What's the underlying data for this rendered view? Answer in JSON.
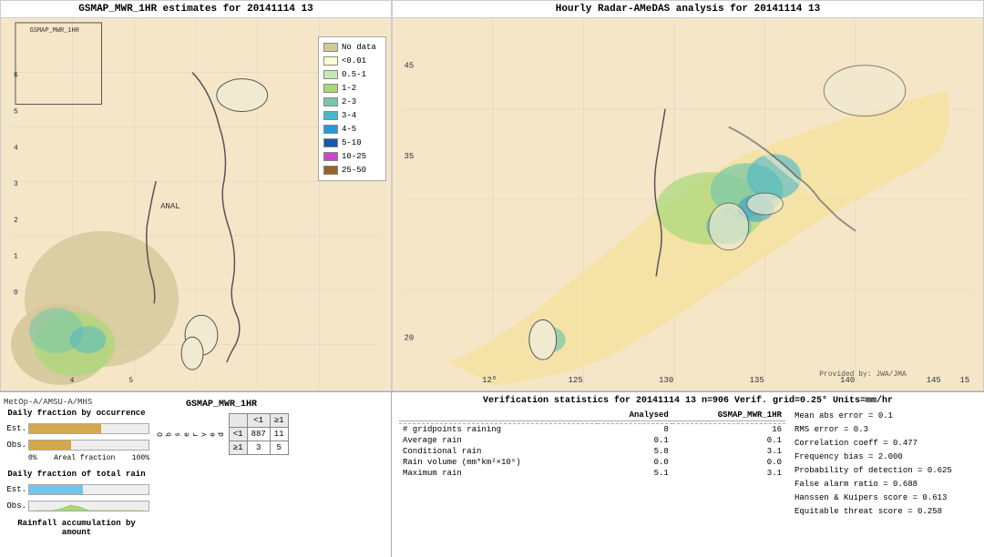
{
  "left_map": {
    "title": "GSMAP_MWR_1HR estimates for 20141114 13",
    "subtitle": "GSMAP_MWR_1HR",
    "anal_label": "ANAL",
    "satellite": "MetOp-A/AMSU-A/MHS"
  },
  "right_map": {
    "title": "Hourly Radar-AMeDAS analysis for 20141114 13",
    "provided_by": "Provided by: JWA/JMA"
  },
  "legend": {
    "title": "",
    "items": [
      {
        "label": "No data",
        "color": "#d4c89a"
      },
      {
        "label": "<0.01",
        "color": "#ffffd4"
      },
      {
        "label": "0.5-1",
        "color": "#c8e8b4"
      },
      {
        "label": "1-2",
        "color": "#a8d878"
      },
      {
        "label": "2-3",
        "color": "#78c8a8"
      },
      {
        "label": "3-4",
        "color": "#48b8c8"
      },
      {
        "label": "4-5",
        "color": "#2898d8"
      },
      {
        "label": "5-10",
        "color": "#1858a8"
      },
      {
        "label": "10-25",
        "color": "#c848c8"
      },
      {
        "label": "25-50",
        "color": "#986428"
      }
    ]
  },
  "charts": {
    "occurrence_title": "Daily fraction by occurrence",
    "total_rain_title": "Daily fraction of total rain",
    "accumulation_title": "Rainfall accumulation by amount",
    "est_label": "Est.",
    "obs_label": "Obs.",
    "axis_left": "0%",
    "axis_right": "100%",
    "axis_mid": "Areal fraction"
  },
  "confusion_matrix": {
    "title": "GSMAP_MWR_1HR",
    "col_lt1": "<1",
    "col_ge1": "≥1",
    "row_lt1": "<1",
    "row_ge1": "≥1",
    "observed_label": "O\nb\ns\ne\nr\nv\ne\nd",
    "val_tt": "887",
    "val_tf": "11",
    "val_ft": "3",
    "val_ff": "5"
  },
  "verification": {
    "title": "Verification statistics for 20141114 13  n=906  Verif. grid=0.25°  Units=mm/hr",
    "headers": [
      "",
      "Analysed",
      "GSMAP_MWR_1HR"
    ],
    "rows": [
      {
        "label": "# gridpoints raining",
        "analysed": "8",
        "gsmap": "16"
      },
      {
        "label": "Average rain",
        "analysed": "0.1",
        "gsmap": "0.1"
      },
      {
        "label": "Conditional rain",
        "analysed": "5.8",
        "gsmap": "3.1"
      },
      {
        "label": "Rain volume (mm*km²×10⁶)",
        "analysed": "0.0",
        "gsmap": "0.0"
      },
      {
        "label": "Maximum rain",
        "analysed": "5.1",
        "gsmap": "3.1"
      }
    ],
    "stats": [
      {
        "label": "Mean abs error = 0.1"
      },
      {
        "label": "RMS error = 0.3"
      },
      {
        "label": "Correlation coeff = 0.477"
      },
      {
        "label": "Frequency bias = 2.000"
      },
      {
        "label": "Probability of detection = 0.625"
      },
      {
        "label": "False alarm ratio = 0.688"
      },
      {
        "label": "Hanssen & Kuipers score = 0.613"
      },
      {
        "label": "Equitable threat score = 0.258"
      }
    ]
  }
}
